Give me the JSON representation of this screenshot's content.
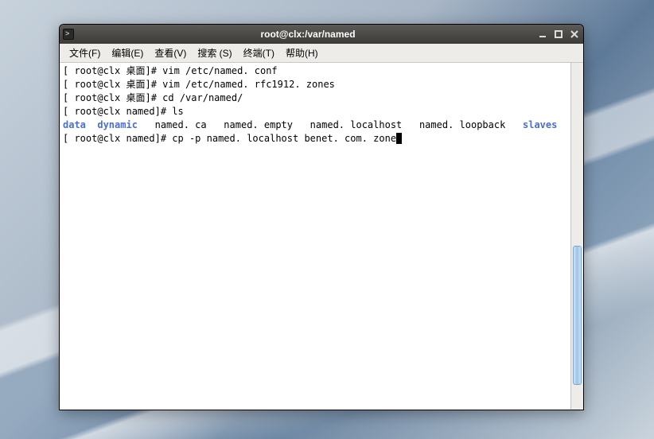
{
  "window": {
    "title": "root@clx:/var/named"
  },
  "menubar": {
    "items": [
      {
        "label": "文件(F)"
      },
      {
        "label": "编辑(E)"
      },
      {
        "label": "查看(V)"
      },
      {
        "label": "搜索 (S)"
      },
      {
        "label": "终端(T)"
      },
      {
        "label": "帮助(H)"
      }
    ]
  },
  "terminal": {
    "lines": [
      {
        "prompt": "[ root@clx 桌面]# ",
        "cmd": "vim /etc/named. conf"
      },
      {
        "prompt": "[ root@clx 桌面]# ",
        "cmd": "vim /etc/named. rfc1912. zones"
      },
      {
        "prompt": "[ root@clx 桌面]# ",
        "cmd": "cd /var/named/"
      },
      {
        "prompt": "[ root@clx named]# ",
        "cmd": "ls"
      }
    ],
    "ls_output": {
      "dirs_left": "data  dynamic",
      "files_mid": "named. ca   named. empty   named. localhost   named. loopback",
      "dirs_right": "slaves"
    },
    "current": {
      "prompt": "[ root@clx named]# ",
      "cmd": "cp -p named. localhost benet. com. zone"
    }
  }
}
